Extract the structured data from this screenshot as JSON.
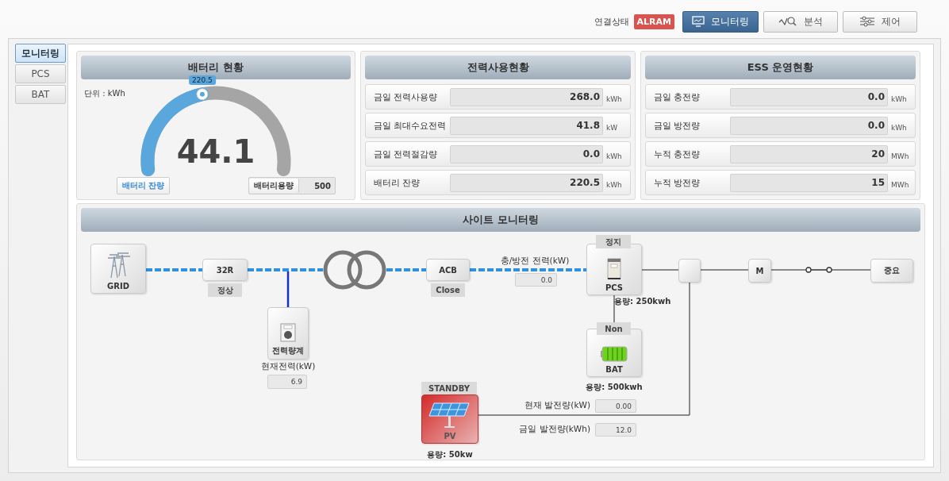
{
  "header": {
    "connection_label": "연결상태",
    "connection_status": "ALRAM",
    "tabs": [
      {
        "kind": "monitor",
        "label": "모니터링",
        "selected": true
      },
      {
        "kind": "analysis",
        "label": "분석",
        "selected": false
      },
      {
        "kind": "control",
        "label": "제어",
        "selected": false
      }
    ]
  },
  "sidebar": {
    "items": [
      {
        "label": "모니터링",
        "selected": true
      },
      {
        "label": "PCS",
        "selected": false
      },
      {
        "label": "BAT",
        "selected": false
      }
    ]
  },
  "battery_panel": {
    "title": "배터리 현황",
    "unit_label": "단위 : kWh",
    "gauge": {
      "level": 0.441,
      "tooltip": "220.5",
      "value": "44.1"
    },
    "remaining_label": "배터리 잔량",
    "capacity_label": "배터리용량",
    "capacity_value": "500"
  },
  "power_usage": {
    "title": "전력사용현황",
    "rows": [
      {
        "label": "금일 전력사용량",
        "value": "268.0",
        "unit": "kWh"
      },
      {
        "label": "금일 최대수요전력",
        "value": "41.8",
        "unit": "kW"
      },
      {
        "label": "금일 전력절감량",
        "value": "0.0",
        "unit": "kWh"
      },
      {
        "label": "배터리 잔량",
        "value": "220.5",
        "unit": "kWh"
      }
    ]
  },
  "ess_status": {
    "title": "ESS 운영현황",
    "rows": [
      {
        "label": "금일 충전량",
        "value": "0.0",
        "unit": "kWh"
      },
      {
        "label": "금일 방전량",
        "value": "0.0",
        "unit": "kWh"
      },
      {
        "label": "누적 충전량",
        "value": "20",
        "unit": "MWh"
      },
      {
        "label": "누적 방전량",
        "value": "15",
        "unit": "MWh"
      }
    ]
  },
  "site_monitoring": {
    "title": "사이트 모니터링",
    "grid": {
      "label": "GRID"
    },
    "relay": {
      "label": "32R",
      "status": "정상"
    },
    "meter": {
      "label": "전력량계",
      "reading_label": "현재전력(kW)",
      "reading": "6.9"
    },
    "acb": {
      "label": "ACB",
      "status": "Close"
    },
    "charge_power": {
      "label": "충/방전 전력(kW)",
      "value": "0.0"
    },
    "pcs": {
      "status": "정지",
      "label": "PCS",
      "capacity": "용량: 250kwh"
    },
    "motor": {
      "label": "M"
    },
    "load": {
      "label": "중요"
    },
    "bat": {
      "status": "Non",
      "label": "BAT",
      "capacity": "용량: 500kwh"
    },
    "pv": {
      "status": "STANDBY",
      "label": "PV",
      "capacity": "용량: 50kw",
      "readings": [
        {
          "label": "현재 발전량(kW)",
          "value": "0.00"
        },
        {
          "label": "금일 발전량(kWh)",
          "value": "12.0"
        }
      ]
    }
  }
}
